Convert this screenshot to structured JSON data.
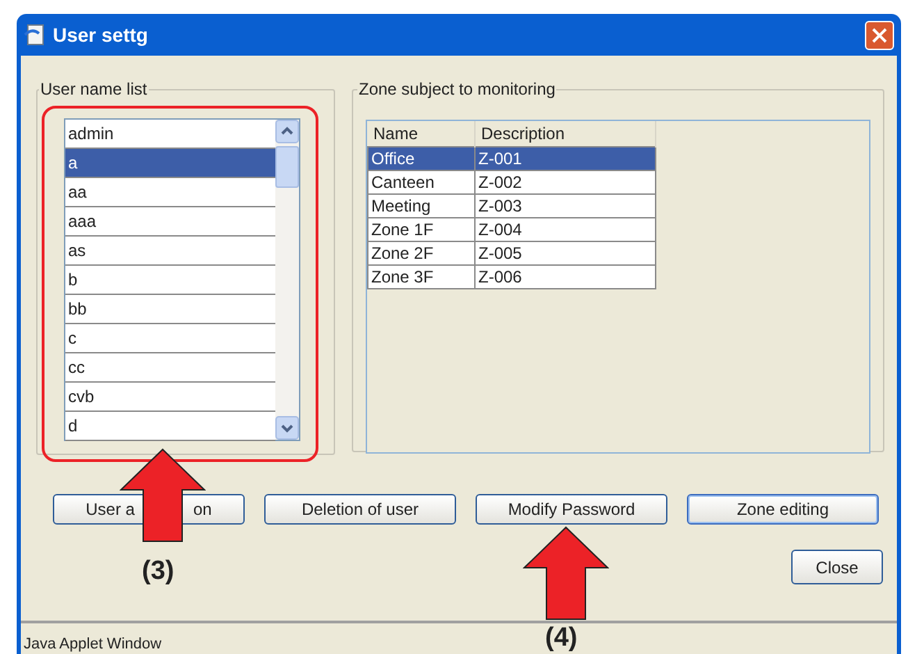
{
  "window": {
    "title": "User settg"
  },
  "user_list": {
    "title": "User name list",
    "items": [
      {
        "label": "admin",
        "selected": false
      },
      {
        "label": "a",
        "selected": true
      },
      {
        "label": "aa",
        "selected": false
      },
      {
        "label": "aaa",
        "selected": false
      },
      {
        "label": "as",
        "selected": false
      },
      {
        "label": "b",
        "selected": false
      },
      {
        "label": "bb",
        "selected": false
      },
      {
        "label": "c",
        "selected": false
      },
      {
        "label": "cc",
        "selected": false
      },
      {
        "label": "cvb",
        "selected": false
      },
      {
        "label": "d",
        "selected": false
      }
    ]
  },
  "zones": {
    "title": "Zone subject to monitoring",
    "columns": [
      "Name",
      "Description"
    ],
    "rows": [
      {
        "cells": [
          "Office",
          "Z-001"
        ],
        "selected": true
      },
      {
        "cells": [
          "Canteen",
          "Z-002"
        ],
        "selected": false
      },
      {
        "cells": [
          "Meeting",
          "Z-003"
        ],
        "selected": false
      },
      {
        "cells": [
          "Zone 1F",
          "Z-004"
        ],
        "selected": false
      },
      {
        "cells": [
          "Zone 2F",
          "Z-005"
        ],
        "selected": false
      },
      {
        "cells": [
          "Zone 3F",
          "Z-006"
        ],
        "selected": false
      }
    ]
  },
  "buttons": [
    {
      "label_parts": [
        "User a",
        "on"
      ]
    },
    {
      "label_parts": [
        "Deletion of user"
      ]
    },
    {
      "label_parts": [
        "Modify Password"
      ]
    },
    {
      "label_parts": [
        "Zone editing"
      ]
    }
  ],
  "close_button": "Close",
  "status_bar": "Java Applet Window",
  "annotations": [
    "(3)",
    "(4)"
  ]
}
